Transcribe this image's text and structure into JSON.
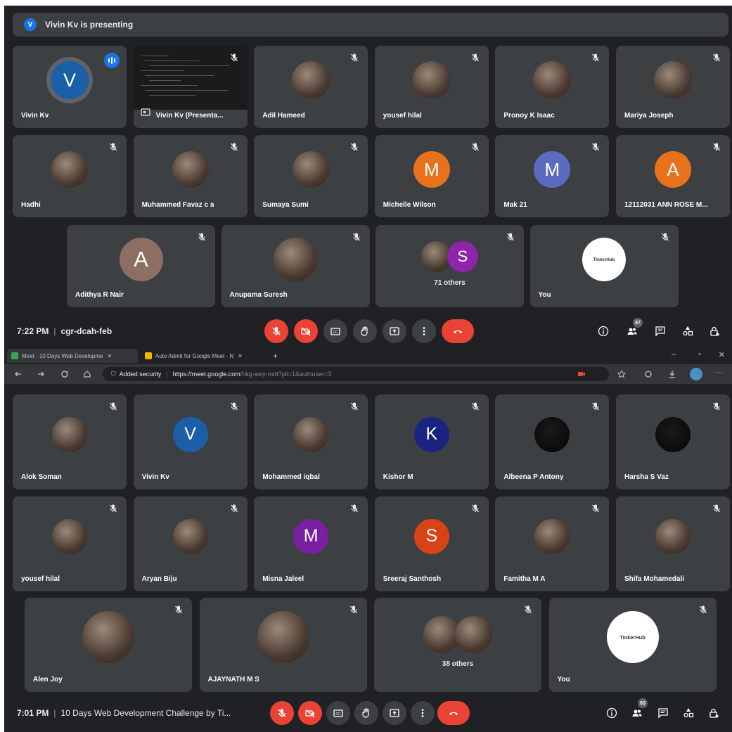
{
  "top_meeting": {
    "banner": {
      "initial": "V",
      "text": "Vivin Kv is presenting"
    },
    "tiles_row1": [
      {
        "name": "Vivin Kv",
        "kind": "initial",
        "initial": "V",
        "color": "#1a5fa8",
        "speaking": true
      },
      {
        "name": "Vivin Kv (Presenta...",
        "kind": "presentation"
      },
      {
        "name": "Adil Hameed",
        "kind": "photo",
        "icon": "avatar-photo"
      },
      {
        "name": "yousef hilal",
        "kind": "photo",
        "icon": "avatar-photo"
      },
      {
        "name": "Pronoy K Isaac",
        "kind": "photo",
        "icon": "avatar-photo"
      },
      {
        "name": "Mariya Joseph",
        "kind": "photo",
        "icon": "avatar-photo"
      }
    ],
    "tiles_row2": [
      {
        "name": "Hadhi",
        "kind": "photo",
        "icon": "avatar-photo"
      },
      {
        "name": "Muhammed Favaz c a",
        "kind": "photo",
        "icon": "avatar-photo"
      },
      {
        "name": "Sumaya Sumi",
        "kind": "photo",
        "icon": "avatar-photo"
      },
      {
        "name": "Michelle Wilson",
        "kind": "initial",
        "initial": "M",
        "color": "#e8711c"
      },
      {
        "name": "Mak 21",
        "kind": "initial",
        "initial": "M",
        "color": "#5c6bc0"
      },
      {
        "name": "12112031 ANN ROSE M...",
        "kind": "initial",
        "initial": "A",
        "color": "#e8711c"
      }
    ],
    "tiles_row3": [
      {
        "name": "Adithya R Nair",
        "kind": "initial",
        "initial": "A",
        "color": "#8d6e63"
      },
      {
        "name": "Anupama Suresh",
        "kind": "photo",
        "icon": "avatar-photo"
      },
      {
        "name": "",
        "kind": "others",
        "label": "71 others",
        "initial": "S",
        "color": "#8e24aa"
      },
      {
        "name": "You",
        "kind": "logo",
        "logo_text": "TinkerHub"
      }
    ],
    "toolbar": {
      "time": "7:22 PM",
      "meeting_code": "cgr-dcah-feb",
      "participants_count": "87"
    }
  },
  "browser": {
    "tabs": [
      {
        "label": "Meet - 10 Days Web Developme",
        "active": true,
        "favicon_color": "#34a853"
      },
      {
        "label": "Auto Admit for Google Meet - N",
        "active": false,
        "favicon_color": "#f4b400"
      }
    ],
    "new_tab": "+",
    "security_label": "Added security",
    "url_host": "https://meet.google.com",
    "url_rest": "/hkg-awy-mdt?pli=1&authuser=3",
    "window_controls": [
      "–",
      "▫",
      "✕"
    ]
  },
  "bottom_meeting": {
    "tiles_row1": [
      {
        "name": "Alok Soman",
        "kind": "photo",
        "icon": "avatar-photo"
      },
      {
        "name": "Vivin Kv",
        "kind": "initial",
        "initial": "V",
        "color": "#1a5fa8"
      },
      {
        "name": "Mohammed iqbal",
        "kind": "photo",
        "icon": "avatar-photo"
      },
      {
        "name": "Kishor M",
        "kind": "initial",
        "initial": "K",
        "color": "#1a237e"
      },
      {
        "name": "Albeena P Antony",
        "kind": "dark",
        "icon": "avatar-photo"
      },
      {
        "name": "Harsha S Vaz",
        "kind": "dark",
        "icon": "avatar-photo"
      }
    ],
    "tiles_row2": [
      {
        "name": "yousef hilal",
        "kind": "photo",
        "icon": "avatar-photo"
      },
      {
        "name": "Aryan Biju",
        "kind": "photo",
        "icon": "avatar-photo"
      },
      {
        "name": "Misna Jaleel",
        "kind": "initial",
        "initial": "M",
        "color": "#7b1fa2"
      },
      {
        "name": "Sreeraj Santhosh",
        "kind": "initial",
        "initial": "S",
        "color": "#d84315"
      },
      {
        "name": "Famitha M A",
        "kind": "photo",
        "icon": "avatar-photo"
      },
      {
        "name": "Shifa Mohamedali",
        "kind": "photo",
        "icon": "avatar-photo"
      }
    ],
    "tiles_row3": [
      {
        "name": "Alen Joy",
        "kind": "photo",
        "icon": "avatar-photo"
      },
      {
        "name": "AJAYNATH M S",
        "kind": "photo",
        "icon": "avatar-photo"
      },
      {
        "name": "",
        "kind": "others",
        "label": "38 others"
      },
      {
        "name": "You",
        "kind": "logo",
        "logo_text": "TinkerHub"
      }
    ],
    "toolbar": {
      "time": "7:01 PM",
      "meeting_title": "10 Days Web Development Challenge by Ti...",
      "participants_count": "63"
    }
  }
}
